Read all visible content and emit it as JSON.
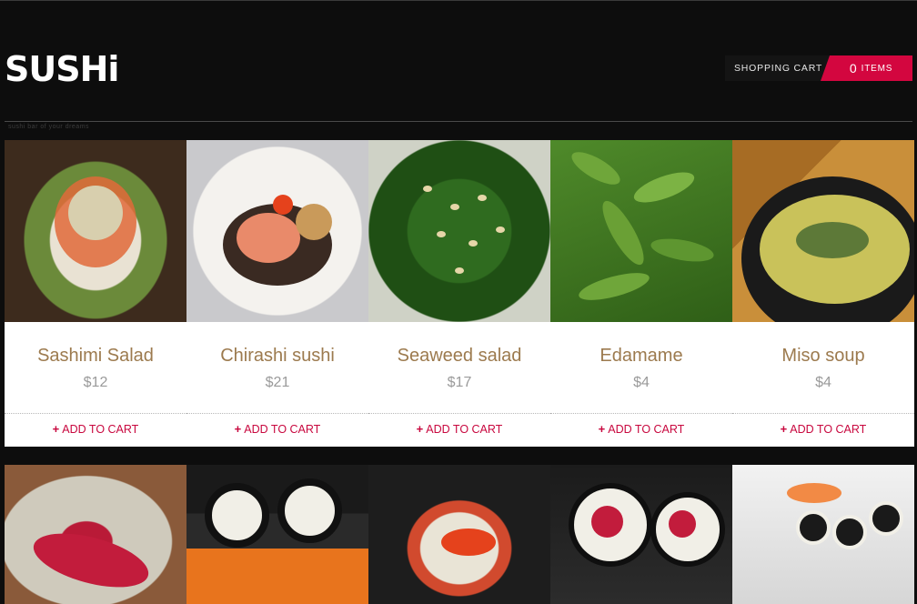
{
  "brand": {
    "logo_text": "SUSHi"
  },
  "tagline": "sushi bar of your dreams",
  "cart": {
    "label": "SHOPPING CART",
    "count": "0",
    "items_label": "ITEMS"
  },
  "colors": {
    "accent": "#d3063f",
    "title": "#9c7a4e",
    "price": "#9a9a9a",
    "background": "#0d0d0d"
  },
  "products": [
    {
      "name": "Sashimi Salad",
      "price": "$12",
      "add_label": "ADD TO CART",
      "add_icon": "plus-icon"
    },
    {
      "name": "Chirashi sushi",
      "price": "$21",
      "add_label": "ADD TO CART",
      "add_icon": "plus-icon"
    },
    {
      "name": "Seaweed salad",
      "price": "$17",
      "add_label": "ADD TO CART",
      "add_icon": "plus-icon"
    },
    {
      "name": "Edamame",
      "price": "$4",
      "add_label": "ADD TO CART",
      "add_icon": "plus-icon"
    },
    {
      "name": "Miso soup",
      "price": "$4",
      "add_label": "ADD TO CART",
      "add_icon": "plus-icon"
    }
  ],
  "plus_symbol": "+"
}
